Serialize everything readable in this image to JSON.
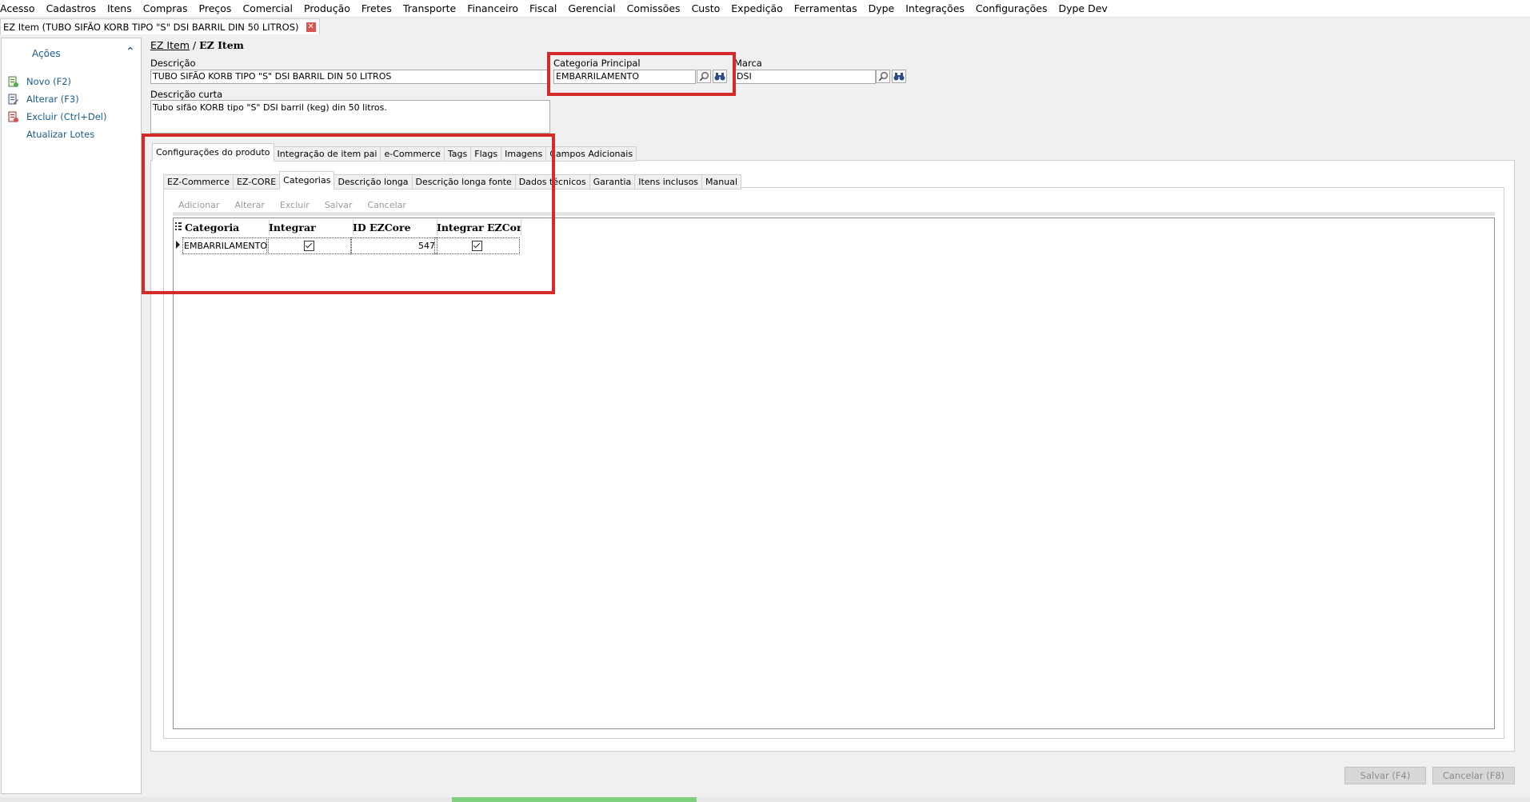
{
  "menu": {
    "items": [
      "Acesso",
      "Cadastros",
      "Itens",
      "Compras",
      "Preços",
      "Comercial",
      "Produção",
      "Fretes",
      "Transporte",
      "Financeiro",
      "Fiscal",
      "Gerencial",
      "Comissões",
      "Custo",
      "Expedição",
      "Ferramentas",
      "Dype",
      "Integrações",
      "Configurações",
      "Dype Dev"
    ]
  },
  "doc_tab": {
    "title": "EZ Item (TUBO SIFÃO KORB TIPO \"S\" DSI BARRIL DIN 50 LITROS)"
  },
  "sidebar": {
    "header": "Ações",
    "actions": [
      {
        "label": "Novo (F2)",
        "icon": "new-document-icon"
      },
      {
        "label": "Alterar (F3)",
        "icon": "edit-document-icon"
      },
      {
        "label": "Excluir (Ctrl+Del)",
        "icon": "delete-document-icon"
      },
      {
        "label": "Atualizar Lotes",
        "icon": ""
      }
    ]
  },
  "breadcrumb": {
    "parent": "EZ Item",
    "separator": "/",
    "current": "EZ Item"
  },
  "form": {
    "descricao_label": "Descrição",
    "descricao_value": "TUBO SIFÃO KORB TIPO \"S\" DSI BARRIL DIN 50 LITROS",
    "categoria_label": "Categoria Principal",
    "categoria_value": "EMBARRILAMENTO",
    "marca_label": "Marca",
    "marca_value": "DSI",
    "descricao_curta_label": "Descrição curta",
    "descricao_curta_value": "Tubo sifão KORB tipo \"S\" DSI barril (keg)  din 50 litros."
  },
  "main_tabs": [
    "Configurações do produto",
    "Integração de item pai",
    "e-Commerce",
    "Tags",
    "Flags",
    "Imagens",
    "Campos Adicionais"
  ],
  "sub_tabs": [
    "EZ-Commerce",
    "EZ-CORE",
    "Categorias",
    "Descrição longa",
    "Descrição longa fonte",
    "Dados técnicos",
    "Garantia",
    "Itens inclusos",
    "Manual"
  ],
  "toolbar": [
    "Adicionar",
    "Alterar",
    "Excluir",
    "Salvar",
    "Cancelar"
  ],
  "grid": {
    "columns": [
      "Categoria",
      "Integrar",
      "ID EZCore",
      "Integrar EZCore"
    ],
    "rows": [
      {
        "categoria": "EMBARRILAMENTO",
        "integrar": true,
        "id_ezcore": "547",
        "integrar_ezcore": true
      }
    ]
  },
  "footer": {
    "save": "Salvar (F4)",
    "cancel": "Cancelar (F8)"
  },
  "colors": {
    "highlight": "#d42a2a",
    "link": "#1a5c8e"
  }
}
